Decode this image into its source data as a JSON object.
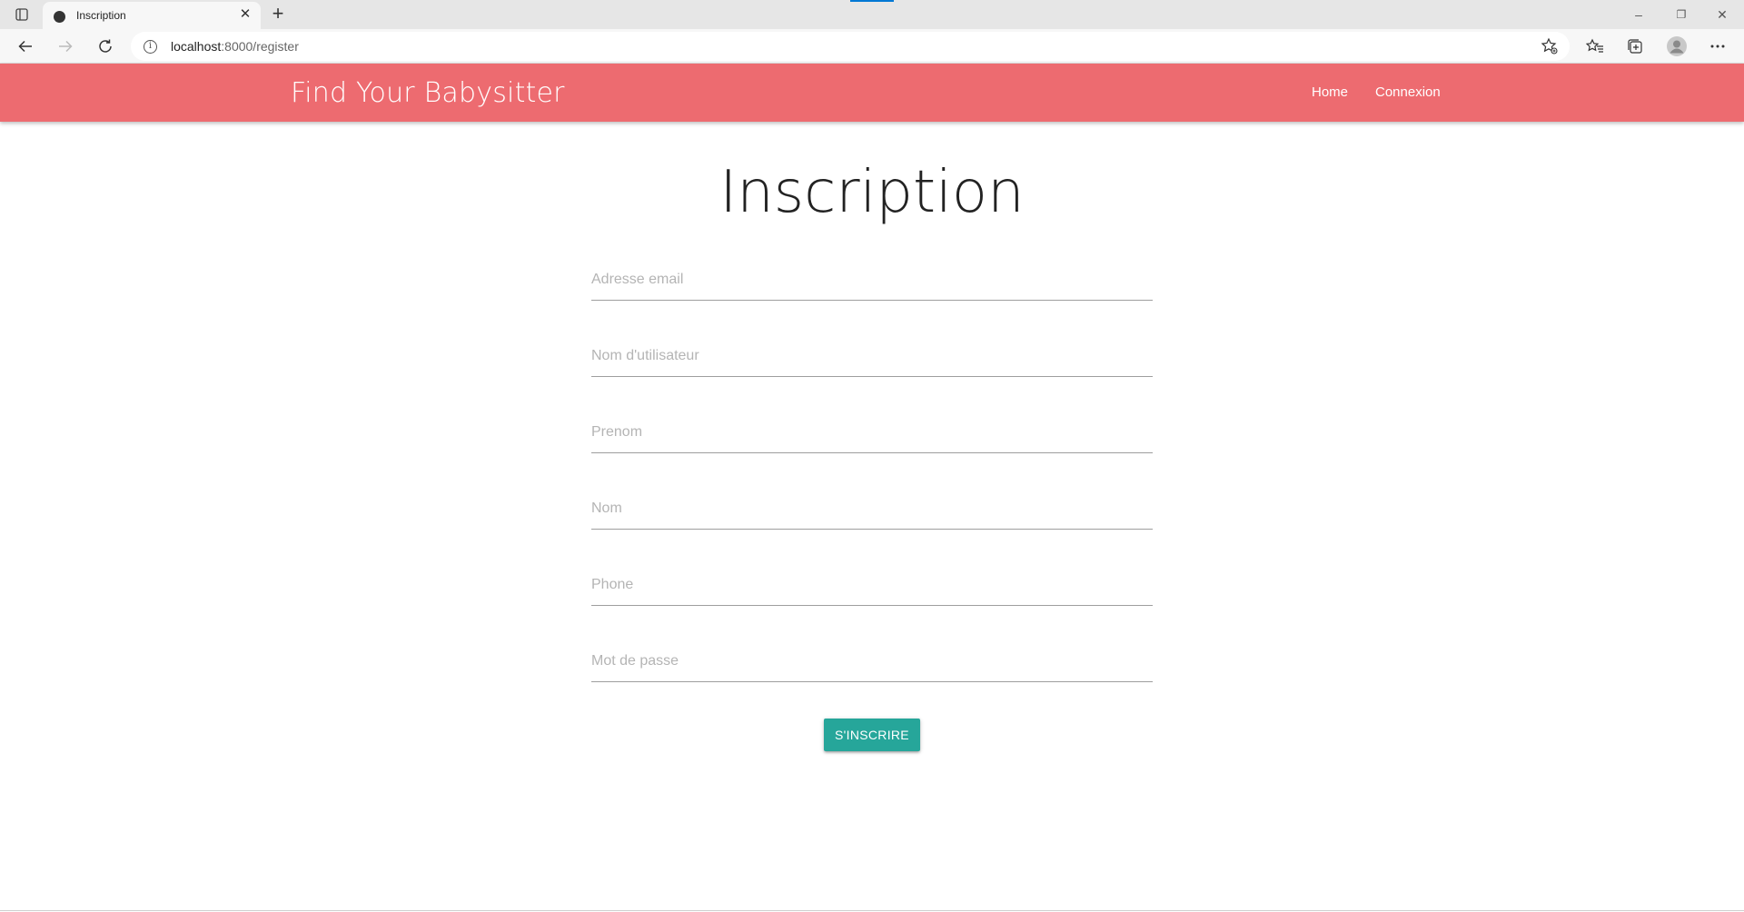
{
  "browser": {
    "tab": {
      "title": "Inscription",
      "close_glyph": "✕"
    },
    "new_tab_glyph": "+",
    "window_controls": {
      "minimize": "–",
      "restore": "❐",
      "close": "✕"
    },
    "url": {
      "host": "localhost",
      "rest": ":8000/register"
    },
    "accent": "#0078d4"
  },
  "navbar": {
    "brand": "Find Your Babysitter",
    "links": [
      "Home",
      "Connexion"
    ],
    "background": "#ed6b70"
  },
  "main": {
    "title": "Inscription",
    "fields": [
      {
        "placeholder": "Adresse email",
        "value": ""
      },
      {
        "placeholder": "Nom d'utilisateur",
        "value": ""
      },
      {
        "placeholder": "Prenom",
        "value": ""
      },
      {
        "placeholder": "Nom",
        "value": ""
      },
      {
        "placeholder": "Phone",
        "value": ""
      },
      {
        "placeholder": "Mot de passe",
        "value": ""
      }
    ],
    "submit_label": "S'INSCRIRE",
    "submit_color": "#26a69a"
  }
}
